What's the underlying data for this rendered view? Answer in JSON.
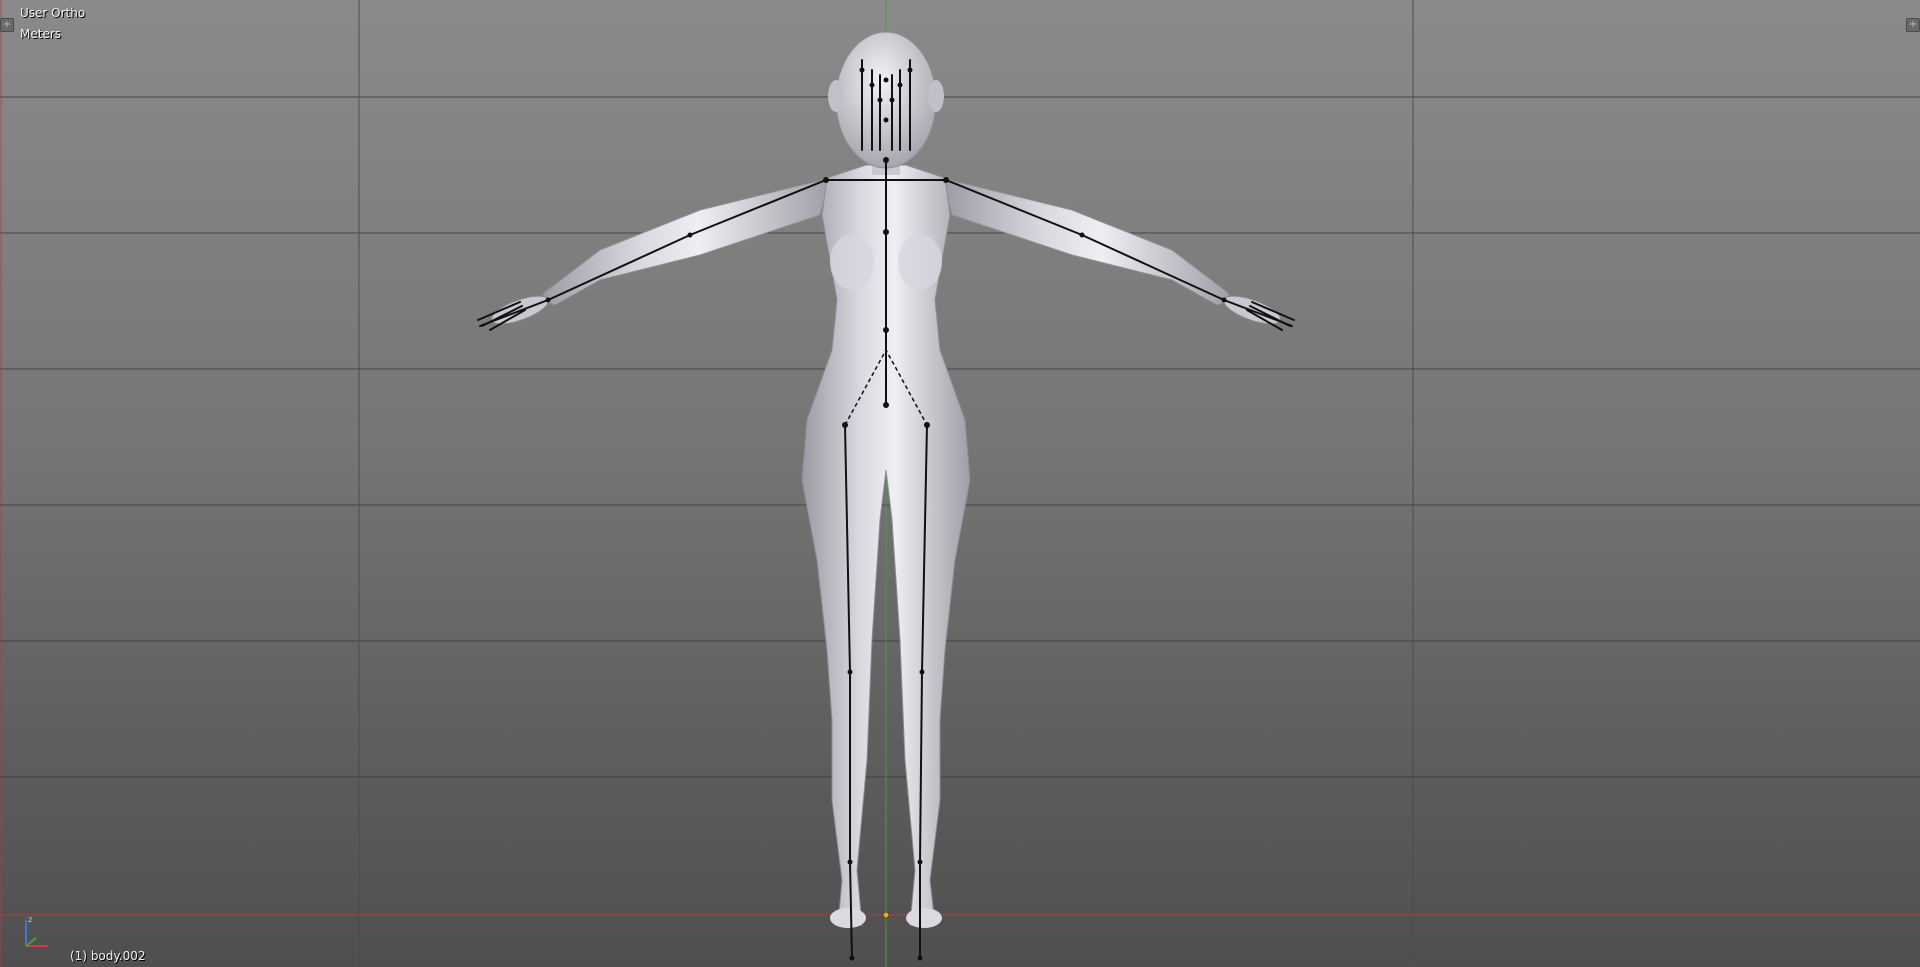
{
  "viewport": {
    "view_name": "User Ortho",
    "units": "Meters",
    "active_object": "(1) body.002"
  },
  "colors": {
    "grid_line": "#3a3a3a",
    "x_axis": "#b03a3a",
    "z_axis": "#4a9a3a",
    "mesh_light": "#e6e6ec",
    "mesh_shadow": "#9a9aa2",
    "bone": "#111111",
    "origin": "#f0a020"
  },
  "icons": {
    "view_split_left": "plus-icon",
    "view_split_right": "plus-icon",
    "axes": "xyz-axes-icon"
  }
}
